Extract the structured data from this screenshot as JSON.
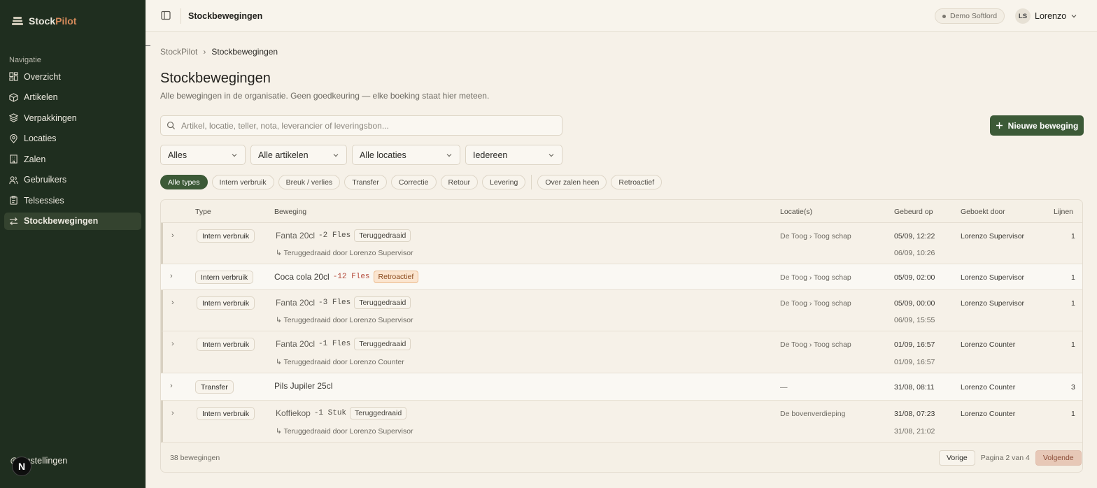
{
  "brand": {
    "part1": "Stock",
    "part2": "Pilot"
  },
  "sidebar": {
    "heading": "Navigatie",
    "items": [
      {
        "label": "Overzicht",
        "icon": "dashboard-icon"
      },
      {
        "label": "Artikelen",
        "icon": "box-icon"
      },
      {
        "label": "Verpakkingen",
        "icon": "layers-icon"
      },
      {
        "label": "Locaties",
        "icon": "map-pin-icon"
      },
      {
        "label": "Zalen",
        "icon": "building-icon"
      },
      {
        "label": "Gebruikers",
        "icon": "users-icon"
      },
      {
        "label": "Telsessies",
        "icon": "clipboard-icon"
      },
      {
        "label": "Stockbewegingen",
        "icon": "arrows-icon",
        "active": true
      }
    ],
    "settings_label": "Instellingen",
    "n_badge": "N"
  },
  "topbar": {
    "title": "Stockbewegingen",
    "demo_label": "Demo Softlord",
    "avatar_initials": "LS",
    "user_name": "Lorenzo"
  },
  "breadcrumb": {
    "root": "StockPilot",
    "separator": "›",
    "current": "Stockbewegingen"
  },
  "page": {
    "title": "Stockbewegingen",
    "subtitle": "Alle bewegingen in de organisatie. Geen goedkeuring — elke boeking staat hier meteen."
  },
  "search": {
    "placeholder": "Artikel, locatie, teller, nota, leverancier of leveringsbon..."
  },
  "new_button": {
    "label": "Nieuwe beweging"
  },
  "filters": {
    "scope": "Alles",
    "articles": "Alle artikelen",
    "locations": "Alle locaties",
    "users": "Iedereen"
  },
  "type_chips": [
    "Alle types",
    "Intern verbruik",
    "Breuk / verlies",
    "Transfer",
    "Correctie",
    "Retour",
    "Levering"
  ],
  "extra_chips": [
    "Over zalen heen",
    "Retroactief"
  ],
  "table": {
    "headers": {
      "type": "Type",
      "movement": "Beweging",
      "locations": "Locatie(s)",
      "occurred": "Gebeurd op",
      "booked_by": "Geboekt door",
      "lines": "Lijnen"
    },
    "rows": [
      {
        "type": "Intern verbruik",
        "article": "Fanta 20cl",
        "qty": "-2 Fles",
        "tag": "Teruggedraaid",
        "location": "De Toog › Toog schap",
        "occurred": "05/09, 12:22",
        "booked_by": "Lorenzo Supervisor",
        "lines": "1",
        "revert_note": "↳ Teruggedraaid door Lorenzo Supervisor",
        "revert_time": "06/09, 10:26"
      },
      {
        "type": "Intern verbruik",
        "article": "Coca cola 20cl",
        "qty": "-12 Fles",
        "tag": "Retroactief",
        "location": "De Toog › Toog schap",
        "occurred": "05/09, 02:00",
        "booked_by": "Lorenzo Supervisor",
        "lines": "1"
      },
      {
        "type": "Intern verbruik",
        "article": "Fanta 20cl",
        "qty": "-3 Fles",
        "tag": "Teruggedraaid",
        "location": "De Toog › Toog schap",
        "occurred": "05/09, 00:00",
        "booked_by": "Lorenzo Supervisor",
        "lines": "1",
        "revert_note": "↳ Teruggedraaid door Lorenzo Supervisor",
        "revert_time": "06/09, 15:55"
      },
      {
        "type": "Intern verbruik",
        "article": "Fanta 20cl",
        "qty": "-1 Fles",
        "tag": "Teruggedraaid",
        "location": "De Toog › Toog schap",
        "occurred": "01/09, 16:57",
        "booked_by": "Lorenzo Counter",
        "lines": "1",
        "revert_note": "↳ Teruggedraaid door Lorenzo Counter",
        "revert_time": "01/09, 16:57"
      },
      {
        "type": "Transfer",
        "article": "Pils Jupiler 25cl",
        "location": "—",
        "occurred": "31/08, 08:11",
        "booked_by": "Lorenzo Counter",
        "lines": "3"
      },
      {
        "type": "Intern verbruik",
        "article": "Koffiekop",
        "qty": "-1 Stuk",
        "tag": "Teruggedraaid",
        "location": "De bovenverdieping",
        "occurred": "31/08, 07:23",
        "booked_by": "Lorenzo Counter",
        "lines": "1",
        "revert_note": "↳ Teruggedraaid door Lorenzo Supervisor",
        "revert_time": "31/08, 21:02"
      }
    ],
    "expand_glyph": "›"
  },
  "footer": {
    "count": "38 bewegingen",
    "prev": "Vorige",
    "page_info": "Pagina 2 van 4",
    "next": "Volgende"
  },
  "colors": {
    "sidebar_bg": "#1f2e1f",
    "accent_green": "#3c5a37",
    "brand_orange": "#d48a5a",
    "retro_bg": "#fbe5cf",
    "negative_qty": "#b44a3a"
  }
}
